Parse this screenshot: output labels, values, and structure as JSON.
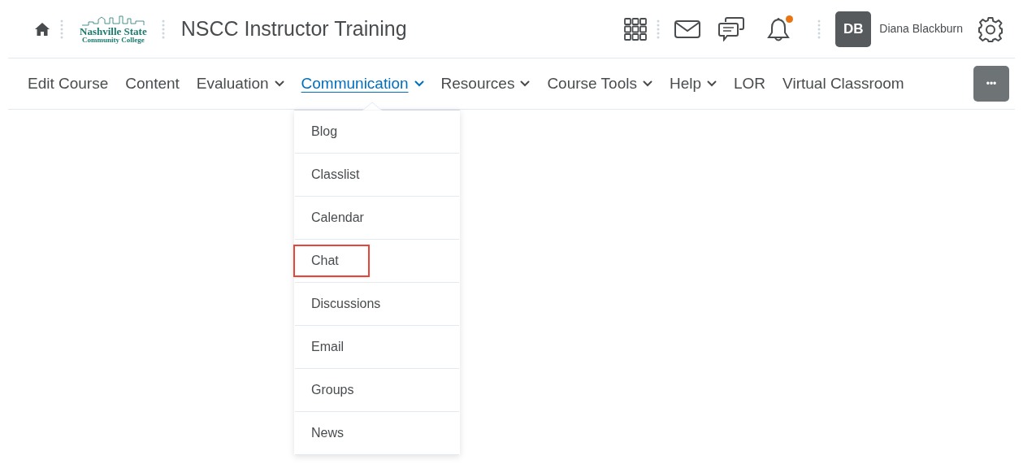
{
  "header": {
    "logo": {
      "line_1": "Nashville State",
      "line_2": "Community College"
    },
    "course_title": "NSCC Instructor Training",
    "notifications": {
      "unread": true
    },
    "user": {
      "initials": "DB",
      "name": "Diana Blackburn"
    }
  },
  "nav": {
    "items": [
      {
        "label": "Edit Course",
        "has_menu": false,
        "selected": false
      },
      {
        "label": "Content",
        "has_menu": false,
        "selected": false
      },
      {
        "label": "Evaluation",
        "has_menu": true,
        "selected": false
      },
      {
        "label": "Communication",
        "has_menu": true,
        "selected": true
      },
      {
        "label": "Resources",
        "has_menu": true,
        "selected": false
      },
      {
        "label": "Course Tools",
        "has_menu": true,
        "selected": false
      },
      {
        "label": "Help",
        "has_menu": true,
        "selected": false
      },
      {
        "label": "LOR",
        "has_menu": false,
        "selected": false
      },
      {
        "label": "Virtual Classroom",
        "has_menu": false,
        "selected": false
      }
    ],
    "more_button": "•••"
  },
  "dropdown": {
    "items": [
      {
        "label": "Blog",
        "highlighted": false
      },
      {
        "label": "Classlist",
        "highlighted": false
      },
      {
        "label": "Calendar",
        "highlighted": false
      },
      {
        "label": "Chat",
        "highlighted": true
      },
      {
        "label": "Discussions",
        "highlighted": false
      },
      {
        "label": "Email",
        "highlighted": false
      },
      {
        "label": "Groups",
        "highlighted": false
      },
      {
        "label": "News",
        "highlighted": false
      }
    ]
  }
}
